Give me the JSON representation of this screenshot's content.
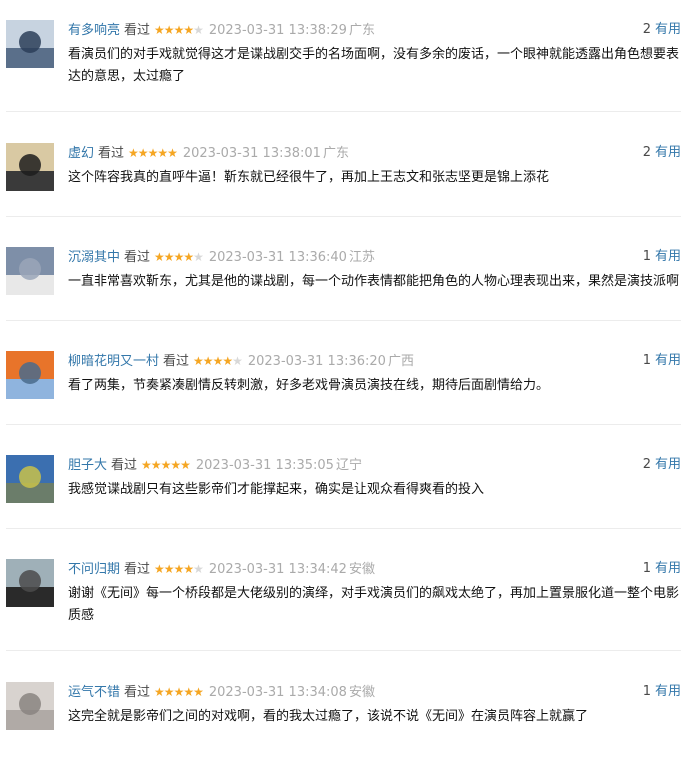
{
  "reviews": [
    {
      "user": "有多响亮",
      "status": "看过",
      "rating": 4,
      "time": "2023-03-31 13:38:29",
      "location": "广东",
      "votes": "2",
      "useful_label": "有用",
      "text": "看演员们的对手戏就觉得这才是谍战剧交手的名场面啊，没有多余的废话，一个眼神就能透露出角色想要表达的意思，太过瘾了",
      "avatar_colors": [
        "#5a6f8a",
        "#c7d3e0",
        "#2c3e58"
      ]
    },
    {
      "user": "虚幻",
      "status": "看过",
      "rating": 5,
      "time": "2023-03-31 13:38:01",
      "location": "广东",
      "votes": "2",
      "useful_label": "有用",
      "text": "这个阵容我真的直呼牛逼！靳东就已经很牛了，再加上王志文和张志坚更是锦上添花",
      "avatar_colors": [
        "#3a3a3a",
        "#d9c9a3",
        "#1d1d1d"
      ]
    },
    {
      "user": "沉溺其中",
      "status": "看过",
      "rating": 4,
      "time": "2023-03-31 13:36:40",
      "location": "江苏",
      "votes": "1",
      "useful_label": "有用",
      "text": "一直非常喜欢靳东，尤其是他的谍战剧，每一个动作表情都能把角色的人物心理表现出来，果然是演技派啊",
      "avatar_colors": [
        "#e8e8e8",
        "#7e8fa8",
        "#9aa6b8"
      ]
    },
    {
      "user": "柳暗花明又一村",
      "status": "看过",
      "rating": 4,
      "time": "2023-03-31 13:36:20",
      "location": "广西",
      "votes": "1",
      "useful_label": "有用",
      "text": "看了两集，节奏紧凑剧情反转刺激，好多老戏骨演员演技在线，期待后面剧情给力。",
      "avatar_colors": [
        "#8fb4de",
        "#e8742a",
        "#4a6b8c"
      ]
    },
    {
      "user": "胆子大",
      "status": "看过",
      "rating": 5,
      "time": "2023-03-31 13:35:05",
      "location": "辽宁",
      "votes": "2",
      "useful_label": "有用",
      "text": "我感觉谍战剧只有这些影帝们才能撑起来，确实是让观众看得爽看的投入",
      "avatar_colors": [
        "#6b7d6a",
        "#3b6fb0",
        "#c9c24a"
      ]
    },
    {
      "user": "不问归期",
      "status": "看过",
      "rating": 4,
      "time": "2023-03-31 13:34:42",
      "location": "安徽",
      "votes": "1",
      "useful_label": "有用",
      "text": "谢谢《无间》每一个桥段都是大佬级别的演绎，对手戏演员们的飙戏太绝了，再加上置景服化道一整个电影质感",
      "avatar_colors": [
        "#2a2a2a",
        "#9fb0b8",
        "#4b4b4b"
      ]
    },
    {
      "user": "运气不错",
      "status": "看过",
      "rating": 5,
      "time": "2023-03-31 13:34:08",
      "location": "安徽",
      "votes": "1",
      "useful_label": "有用",
      "text": "这完全就是影帝们之间的对戏啊，看的我太过瘾了，该说不说《无间》在演员阵容上就赢了",
      "avatar_colors": [
        "#b0aaa6",
        "#d8d3cf",
        "#8a8480"
      ]
    }
  ]
}
